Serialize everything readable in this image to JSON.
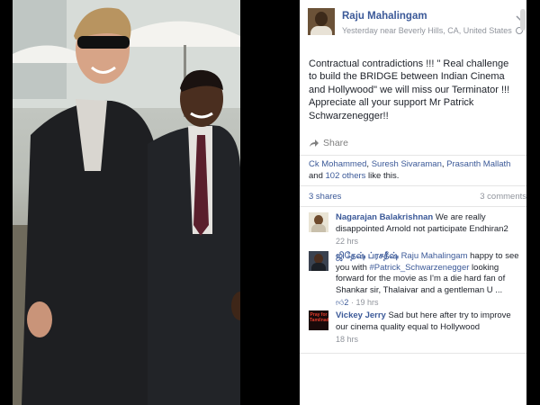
{
  "post": {
    "author": "Raju Mahalingam",
    "meta": "Yesterday near Beverly Hills, CA, United States",
    "icons": {
      "privacy": "globe-icon",
      "menu": "chevron-down-icon"
    },
    "text": "Contractual contradictions !!! \" Real challenge to build the BRIDGE between Indian Cinema and Hollywood\" we will miss our Terminator !!! Appreciate all your support Mr Patrick Schwarzenegger!!"
  },
  "actions": {
    "share_label": "Share",
    "share_icon": "share-arrow-icon"
  },
  "likes": {
    "names": [
      "Ck Mohammed",
      "Suresh Sivaraman",
      "Prasanth Mallath"
    ],
    "sep1": ", ",
    "sep2": ", ",
    "and": " and ",
    "others": "102 others",
    "suffix": " like this."
  },
  "counts": {
    "shares": "3 shares",
    "comments": "3 comments"
  },
  "comments": [
    {
      "author": "Nagarajan Balakrishnan",
      "text": "We are really disappointed Arnold not participate Endhiran2",
      "time": "22 hrs"
    },
    {
      "author": "ஜிதேஷ் ப்ரசதீஷ்",
      "mention": "Raju Mahalingam",
      "text_1": "happy to see you with",
      "hashtag": "#Patrick_Schwarzenegger",
      "text_2": "looking forward for the movie as I'm a die hard fan of Shankar sir, Thalaivar and a gentleman U ...",
      "likes": "2",
      "like_icon": "thumbs-up-icon",
      "time": "19 hrs"
    },
    {
      "author": "Vickey Jerry",
      "text": "Sad but here after try to improve our cinema quality equal to Hollywood",
      "time": "18 hrs",
      "avatar_text": "Pray for Tamilnadu"
    }
  ],
  "colors": {
    "link": "#3b5998",
    "text": "#1d2129",
    "muted": "#90949c",
    "background": "#000000"
  }
}
